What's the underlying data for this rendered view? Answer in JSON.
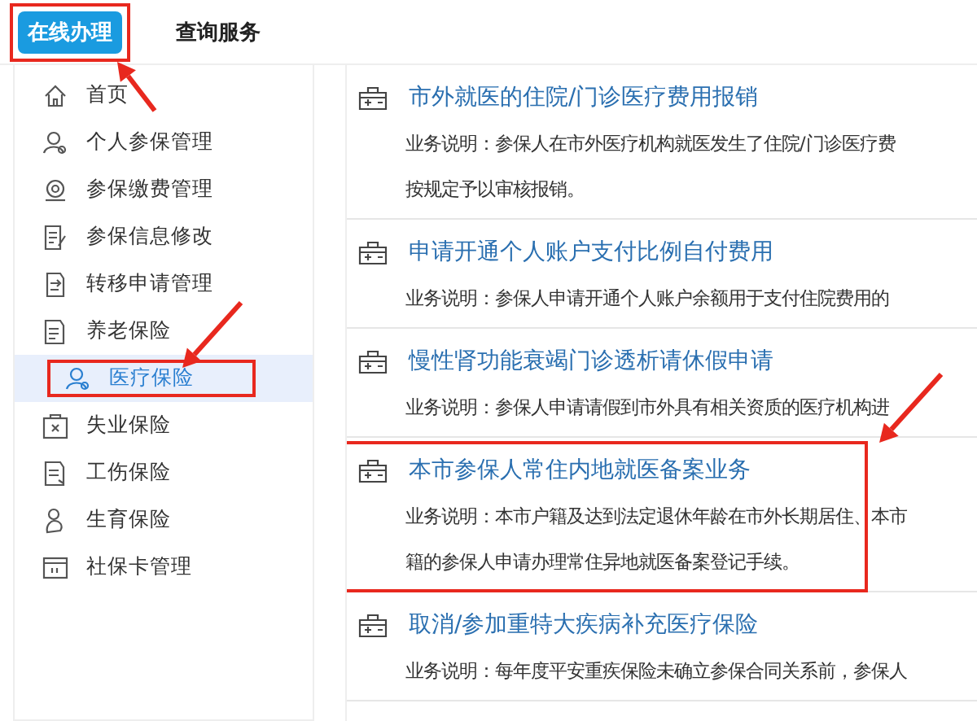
{
  "tabs": [
    {
      "label": "在线办理",
      "selected": true,
      "highlighted": true
    },
    {
      "label": "查询服务",
      "selected": false,
      "highlighted": false
    }
  ],
  "sidebar": {
    "items": [
      {
        "label": "首页",
        "selected": false,
        "highlighted": false
      },
      {
        "label": "个人参保管理",
        "selected": false,
        "highlighted": false
      },
      {
        "label": "参保缴费管理",
        "selected": false,
        "highlighted": false
      },
      {
        "label": "参保信息修改",
        "selected": false,
        "highlighted": false
      },
      {
        "label": "转移申请管理",
        "selected": false,
        "highlighted": false
      },
      {
        "label": "养老保险",
        "selected": false,
        "highlighted": false
      },
      {
        "label": "医疗保险",
        "selected": true,
        "highlighted": true
      },
      {
        "label": "失业保险",
        "selected": false,
        "highlighted": false
      },
      {
        "label": "工伤保险",
        "selected": false,
        "highlighted": false
      },
      {
        "label": "生育保险",
        "selected": false,
        "highlighted": false
      },
      {
        "label": "社保卡管理",
        "selected": false,
        "highlighted": false
      }
    ]
  },
  "services": [
    {
      "title": "市外就医的住院/门诊医疗费用报销",
      "description": [
        "业务说明：参保人在市外医疗机构就医发生了住院/门诊医疗费",
        "按规定予以审核报销。"
      ],
      "highlighted": false
    },
    {
      "title": "申请开通个人账户支付比例自付费用",
      "description": [
        "业务说明：参保人申请开通个人账户余额用于支付住院费用的"
      ],
      "highlighted": false
    },
    {
      "title": "慢性肾功能衰竭门诊透析请休假申请",
      "description": [
        "业务说明：参保人申请请假到市外具有相关资质的医疗机构进"
      ],
      "highlighted": false
    },
    {
      "title": "本市参保人常住内地就医备案业务",
      "description": [
        "业务说明：本市户籍及达到法定退休年龄在市外长期居住、本市",
        "籍的参保人申请办理常住异地就医备案登记手续。"
      ],
      "highlighted": true
    },
    {
      "title": "取消/参加重特大疾病补充医疗保险",
      "description": [
        "业务说明：每年度平安重疾保险未确立参保合同关系前，参保人"
      ],
      "highlighted": false
    }
  ]
}
